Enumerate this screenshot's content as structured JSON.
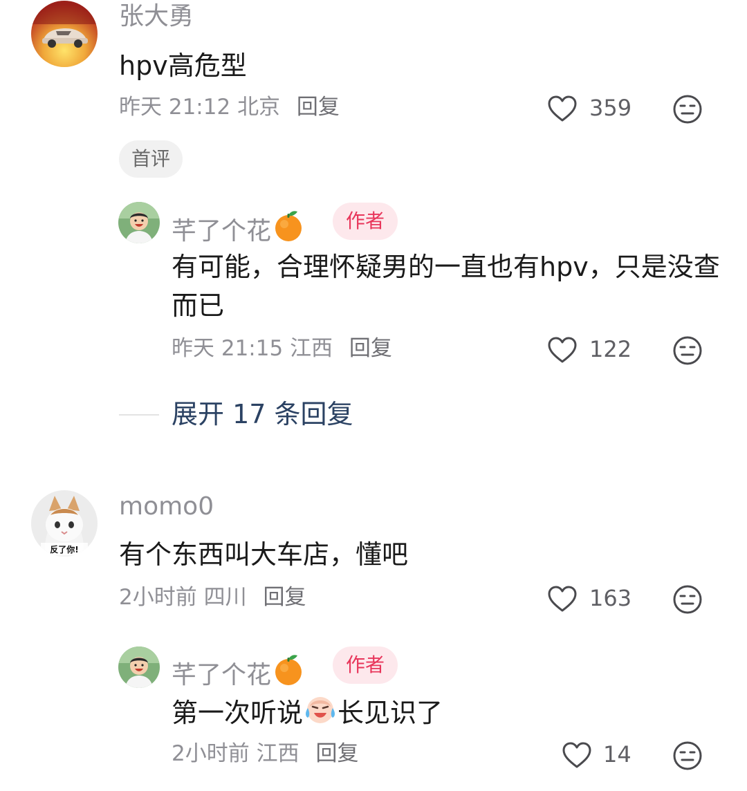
{
  "comments": [
    {
      "user": "张大勇",
      "text": "hpv高危型",
      "time": "昨天 21:12",
      "location": "北京",
      "reply_label": "回复",
      "likes": "359",
      "badge": "首评",
      "reply": {
        "user": "芊了个花",
        "author_badge": "作者",
        "text": "有可能，合理怀疑男的一直也有hpv，只是没查而已",
        "time": "昨天 21:15",
        "location": "江西",
        "reply_label": "回复",
        "likes": "122"
      },
      "expand": "展开 17 条回复"
    },
    {
      "user": "momo0",
      "avatar_caption": "反了你!",
      "text": "有个东西叫大车店，懂吧",
      "time": "2小时前",
      "location": "四川",
      "reply_label": "回复",
      "likes": "163",
      "reply": {
        "user": "芊了个花",
        "author_badge": "作者",
        "text_before": "第一次听说",
        "text_after": "长见识了",
        "time": "2小时前",
        "location": "江西",
        "reply_label": "回复",
        "likes": "14"
      }
    }
  ],
  "icons": {
    "like": "heart-outline-icon",
    "dislike": "meh-face-icon",
    "user_emoji": "tangerine-icon",
    "inline_emoji": "crying-laughing-icon"
  },
  "colors": {
    "author_badge_bg": "#fde8ec",
    "author_badge_text": "#e8355a",
    "expand_text": "#2b4263",
    "meta_text": "#8f8f95"
  }
}
